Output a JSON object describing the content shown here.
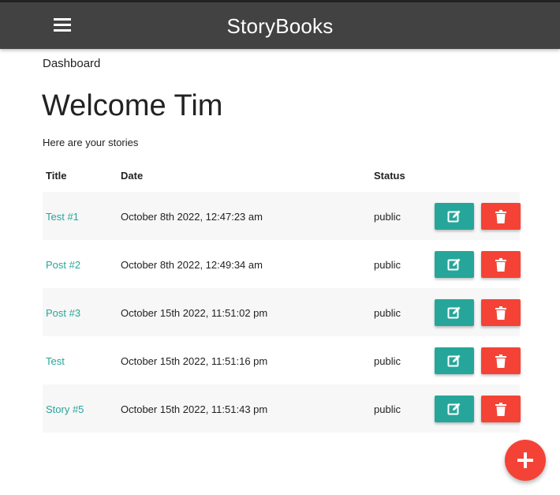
{
  "navbar": {
    "brand": "StoryBooks"
  },
  "breadcrumb": "Dashboard",
  "welcome": "Welcome Tim",
  "subtitle": "Here are your stories",
  "table": {
    "headers": {
      "title": "Title",
      "date": "Date",
      "status": "Status"
    },
    "rows": [
      {
        "title": "Test #1",
        "date": "October 8th 2022, 12:47:23 am",
        "status": "public"
      },
      {
        "title": "Post #2",
        "date": "October 8th 2022, 12:49:34 am",
        "status": "public"
      },
      {
        "title": "Post #3",
        "date": "October 15th 2022, 11:51:02 pm",
        "status": "public"
      },
      {
        "title": "Test",
        "date": "October 15th 2022, 11:51:16 pm",
        "status": "public"
      },
      {
        "title": "Story #5",
        "date": "October 15th 2022, 11:51:43 pm",
        "status": "public"
      }
    ]
  },
  "colors": {
    "navbar": "#424242",
    "link": "#26a69a",
    "edit_button": "#26a69a",
    "delete_button": "#f44336",
    "fab": "#f44336"
  },
  "icons": {
    "menu": "hamburger-menu-icon",
    "edit": "edit-icon",
    "delete": "trash-icon",
    "add": "plus-icon"
  }
}
